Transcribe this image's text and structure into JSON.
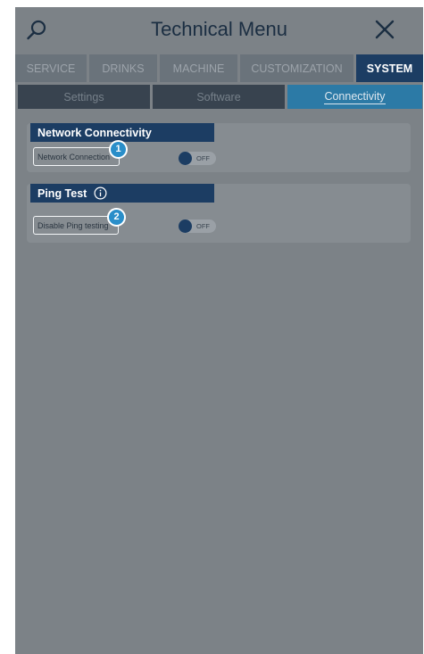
{
  "header": {
    "title": "Technical Menu",
    "search_icon": "search-icon",
    "close_icon": "close-icon"
  },
  "tabs": [
    {
      "label": "SERVICE",
      "active": false
    },
    {
      "label": "DRINKS",
      "active": false
    },
    {
      "label": "MACHINE",
      "active": false
    },
    {
      "label": "CUSTOMIZATION",
      "active": false
    },
    {
      "label": "SYSTEM",
      "active": true
    }
  ],
  "subtabs": [
    {
      "label": "Settings",
      "active": false
    },
    {
      "label": "Software",
      "active": false
    },
    {
      "label": "Connectivity",
      "active": true
    }
  ],
  "sections": {
    "network": {
      "title": "Network Connectivity",
      "setting_label": "Network Connection",
      "toggle_state": "OFF",
      "callout": "1"
    },
    "ping": {
      "title": "Ping Test",
      "info_icon": "info-icon",
      "setting_label": "Disable Ping testing",
      "toggle_state": "OFF",
      "callout": "2"
    }
  },
  "colors": {
    "screen_bg": "#7c8287",
    "active_tab": "#1c3d63",
    "active_subtab": "#2c7aa6",
    "callout": "#2a8ec9"
  }
}
